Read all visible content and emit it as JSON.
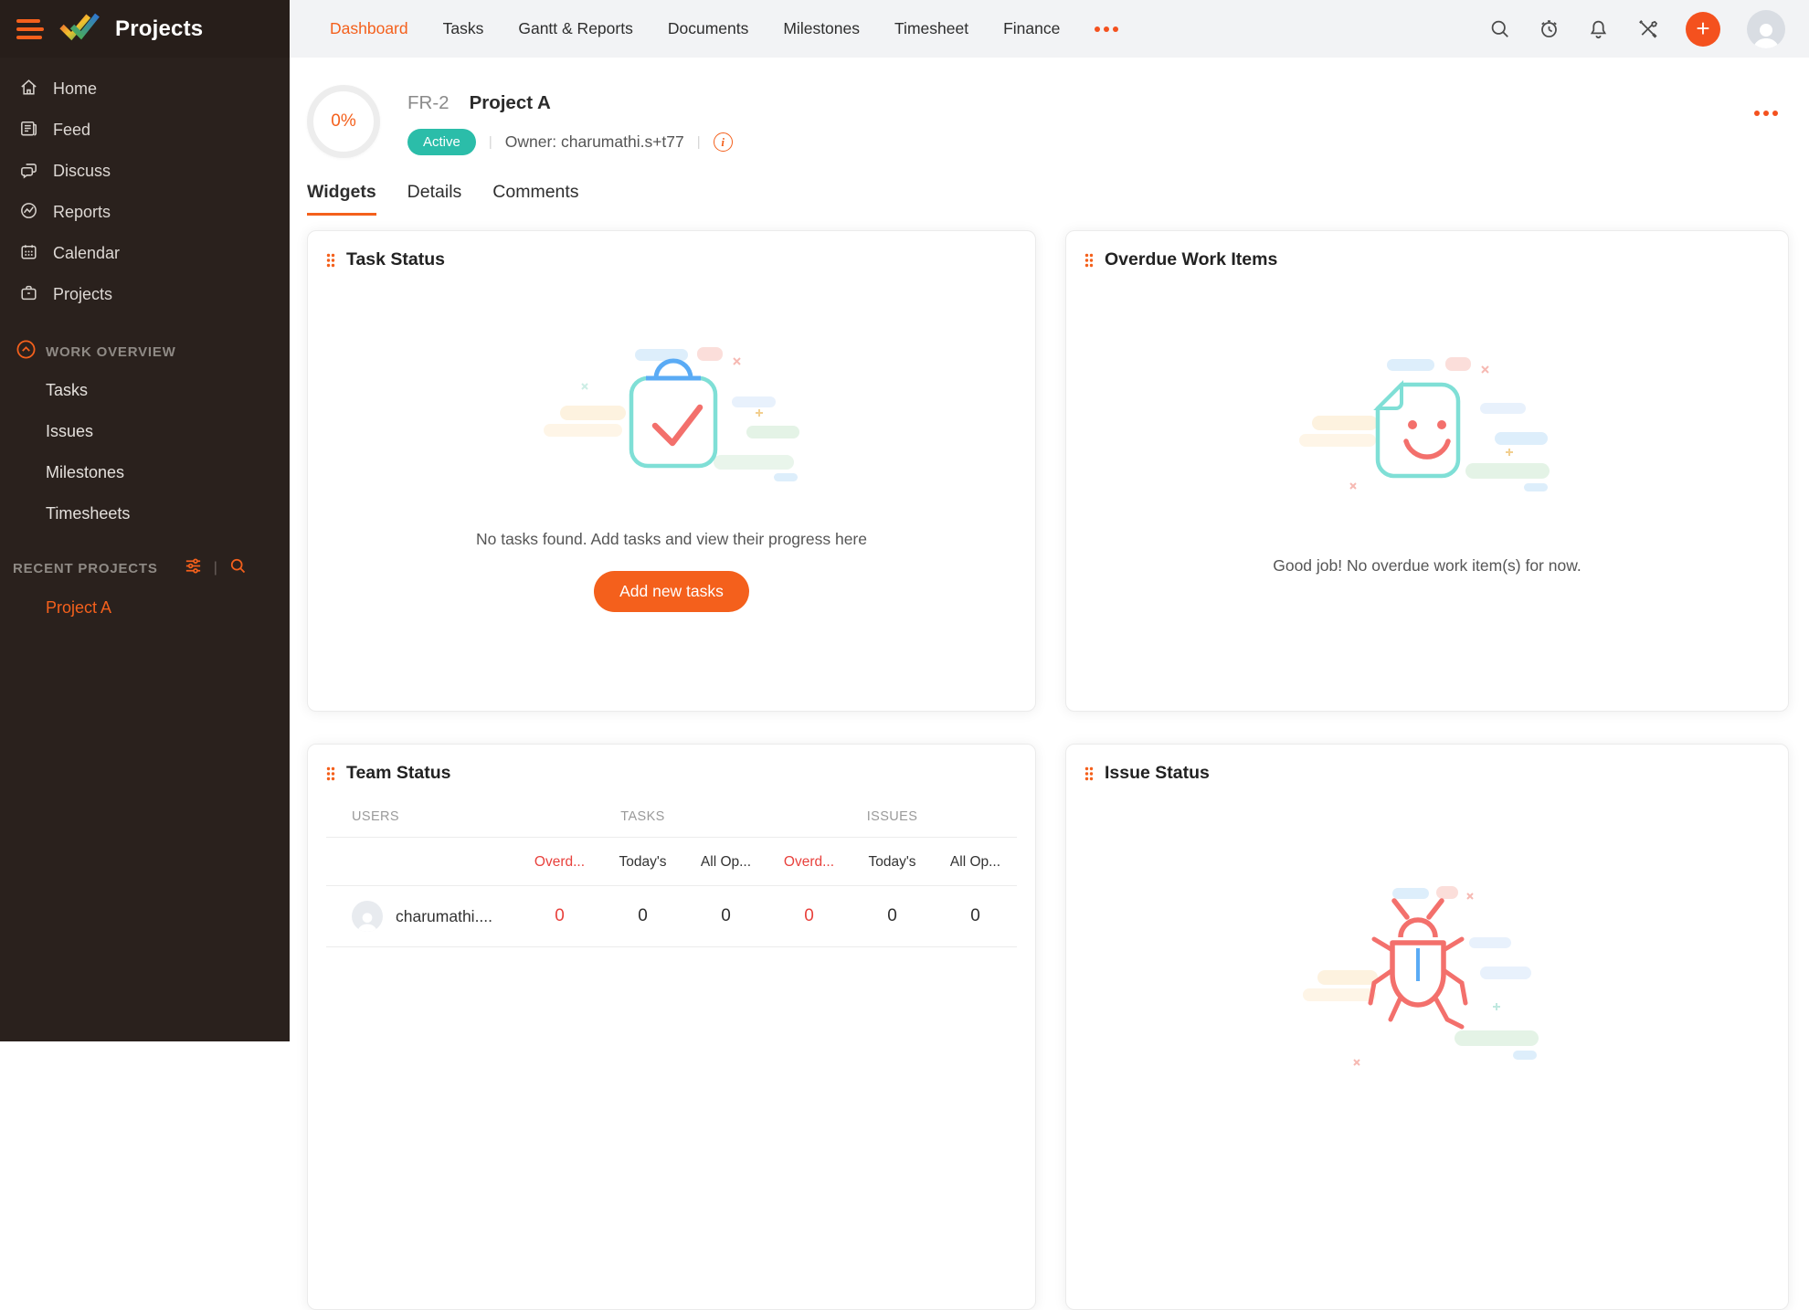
{
  "app": {
    "title": "Projects",
    "logo_icon": "double-check-logo",
    "menu_icon": "hamburger-icon"
  },
  "topnav": {
    "items": [
      {
        "label": "Dashboard"
      },
      {
        "label": "Tasks"
      },
      {
        "label": "Gantt & Reports"
      },
      {
        "label": "Documents"
      },
      {
        "label": "Milestones"
      },
      {
        "label": "Timesheet"
      },
      {
        "label": "Finance"
      }
    ],
    "active": "Dashboard",
    "more_icon": "more-horizontal-icon",
    "right_icons": [
      "search-icon",
      "timer-icon",
      "bell-icon",
      "tools-icon",
      "plus-icon",
      "avatar"
    ],
    "plus_glyph": "+"
  },
  "sidebar": {
    "items": [
      {
        "label": "Home",
        "icon": "home-icon"
      },
      {
        "label": "Feed",
        "icon": "feed-icon"
      },
      {
        "label": "Discuss",
        "icon": "discuss-icon"
      },
      {
        "label": "Reports",
        "icon": "reports-icon"
      },
      {
        "label": "Calendar",
        "icon": "calendar-icon"
      },
      {
        "label": "Projects",
        "icon": "briefcase-icon"
      }
    ],
    "work_overview": {
      "label": "WORK OVERVIEW",
      "collapse_icon": "chevron-up-circle-icon",
      "items": [
        {
          "label": "Tasks"
        },
        {
          "label": "Issues"
        },
        {
          "label": "Milestones"
        },
        {
          "label": "Timesheets"
        }
      ]
    },
    "recent": {
      "label": "RECENT PROJECTS",
      "filter_icon": "filter-sliders-icon",
      "separator": "|",
      "search_icon": "search-icon",
      "projects": [
        {
          "label": "Project A"
        }
      ]
    }
  },
  "project_header": {
    "progress": "0%",
    "code": "FR-2",
    "title": "Project A",
    "status_badge": "Active",
    "separator": "|",
    "owner_label": "Owner:",
    "owner_value": "charumathi.s+t77",
    "owner_text": "Owner: charumathi.s+t77",
    "info_icon": "info-icon",
    "info_glyph": "i",
    "more_icon": "more-horizontal-icon"
  },
  "tabs": {
    "items": [
      {
        "label": "Widgets"
      },
      {
        "label": "Details"
      },
      {
        "label": "Comments"
      }
    ],
    "active": "Widgets"
  },
  "widgets": {
    "task_status": {
      "title": "Task Status",
      "drag_icon": "drag-handle-icon",
      "empty_icon": "task-bag-check-icon",
      "empty_text": "No tasks found. Add tasks and view their progress here",
      "button_label": "Add new tasks"
    },
    "overdue_work_items": {
      "title": "Overdue Work Items",
      "drag_icon": "drag-handle-icon",
      "empty_icon": "smiley-page-icon",
      "empty_text": "Good job! No overdue work item(s) for now."
    },
    "team_status": {
      "title": "Team Status",
      "drag_icon": "drag-handle-icon",
      "group_headers": {
        "users": "USERS",
        "tasks": "TASKS",
        "issues": "ISSUES"
      },
      "sub_headers": [
        "Overd...",
        "Today's",
        "All Op...",
        "Overd...",
        "Today's",
        "All Op..."
      ],
      "rows": [
        {
          "user": "charumathi....",
          "avatar_icon": "avatar",
          "values": [
            "0",
            "0",
            "0",
            "0",
            "0",
            "0"
          ]
        }
      ]
    },
    "issue_status": {
      "title": "Issue Status",
      "drag_icon": "drag-handle-icon",
      "empty_icon": "bug-icon"
    }
  },
  "colors": {
    "accent_orange": "#f4601c",
    "plus_orange": "#f4511e",
    "badge_teal": "#2bbda9",
    "alert_red": "#e8413c",
    "illustration_coral": "#f3706c",
    "illustration_teal": "#7fdfd6",
    "illustration_blue": "#5aabf5",
    "sidebar_bg": "#2a211d",
    "topbar_bg": "#f2f3f5"
  }
}
